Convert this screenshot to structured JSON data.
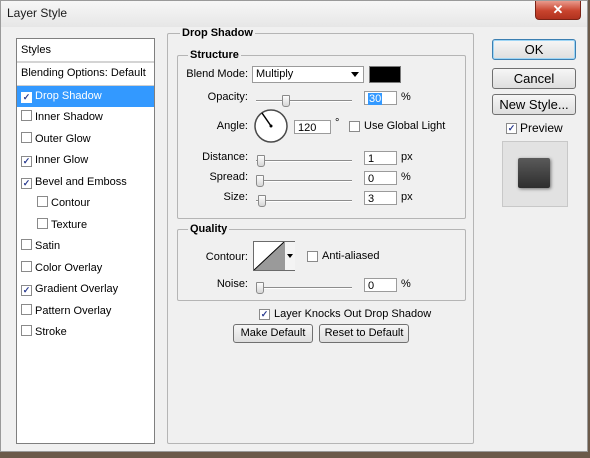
{
  "window": {
    "title": "Layer Style",
    "close_glyph": "✕"
  },
  "styles_panel": {
    "header": "Styles",
    "items": [
      {
        "label": "Blending Options: Default",
        "checkbox": false,
        "checked": false,
        "selected": false,
        "sub": false
      },
      {
        "label": "Drop Shadow",
        "checkbox": true,
        "checked": true,
        "selected": true,
        "sub": false
      },
      {
        "label": "Inner Shadow",
        "checkbox": true,
        "checked": false,
        "selected": false,
        "sub": false
      },
      {
        "label": "Outer Glow",
        "checkbox": true,
        "checked": false,
        "selected": false,
        "sub": false
      },
      {
        "label": "Inner Glow",
        "checkbox": true,
        "checked": true,
        "selected": false,
        "sub": false
      },
      {
        "label": "Bevel and Emboss",
        "checkbox": true,
        "checked": true,
        "selected": false,
        "sub": false
      },
      {
        "label": "Contour",
        "checkbox": true,
        "checked": false,
        "selected": false,
        "sub": true
      },
      {
        "label": "Texture",
        "checkbox": true,
        "checked": false,
        "selected": false,
        "sub": true
      },
      {
        "label": "Satin",
        "checkbox": true,
        "checked": false,
        "selected": false,
        "sub": false
      },
      {
        "label": "Color Overlay",
        "checkbox": true,
        "checked": false,
        "selected": false,
        "sub": false
      },
      {
        "label": "Gradient Overlay",
        "checkbox": true,
        "checked": true,
        "selected": false,
        "sub": false
      },
      {
        "label": "Pattern Overlay",
        "checkbox": true,
        "checked": false,
        "selected": false,
        "sub": false
      },
      {
        "label": "Stroke",
        "checkbox": true,
        "checked": false,
        "selected": false,
        "sub": false
      }
    ]
  },
  "drop_shadow": {
    "title": "Drop Shadow",
    "structure": {
      "title": "Structure",
      "blend_mode_label": "Blend Mode:",
      "blend_mode_value": "Multiply",
      "shadow_color": "#000000",
      "opacity_label": "Opacity:",
      "opacity_value": "30",
      "opacity_fraction": 0.3,
      "opacity_unit": "%",
      "angle_label": "Angle:",
      "angle_value": "120",
      "angle_unit": "°",
      "use_global_light_label": "Use Global Light",
      "distance_label": "Distance:",
      "distance_value": "1",
      "distance_fraction": 0.01,
      "distance_unit": "px",
      "spread_label": "Spread:",
      "spread_value": "0",
      "spread_fraction": 0,
      "spread_unit": "%",
      "size_label": "Size:",
      "size_value": "3",
      "size_fraction": 0.02,
      "size_unit": "px"
    },
    "quality": {
      "title": "Quality",
      "contour_label": "Contour:",
      "anti_aliased_label": "Anti-aliased",
      "noise_label": "Noise:",
      "noise_value": "0",
      "noise_fraction": 0,
      "noise_unit": "%"
    },
    "knocks_out_label": "Layer Knocks Out Drop Shadow",
    "make_default_label": "Make Default",
    "reset_default_label": "Reset to Default"
  },
  "buttons": {
    "ok": "OK",
    "cancel": "Cancel",
    "new_style": "New Style...",
    "preview_label": "Preview"
  },
  "colors": {
    "selection": "#3399ff",
    "preview_swatch": "#3c3c3c"
  }
}
